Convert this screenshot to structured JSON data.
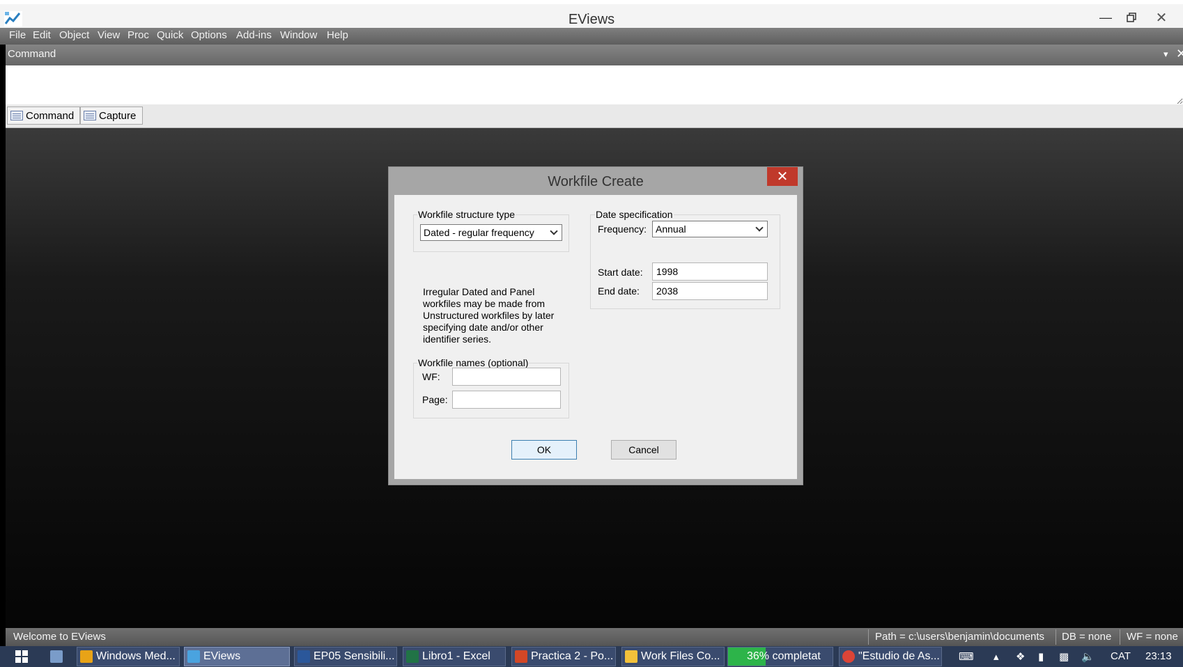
{
  "window": {
    "title": "EViews"
  },
  "menu": [
    "File",
    "Edit",
    "Object",
    "View",
    "Proc",
    "Quick",
    "Options",
    "Add-ins",
    "Window",
    "Help"
  ],
  "command": {
    "title": "Command",
    "tabs": [
      "Command",
      "Capture"
    ]
  },
  "dialog": {
    "title": "Workfile Create",
    "structure_group": "Workfile structure type",
    "structure_value": "Dated - regular frequency",
    "info": "Irregular Dated and Panel workfiles may be made from Unstructured workfiles by later specifying date and/or other identifier series.",
    "date_group": "Date specification",
    "frequency_label": "Frequency:",
    "frequency_value": "Annual",
    "start_label": "Start date:",
    "start_value": "1998",
    "end_label": "End date:",
    "end_value": "2038",
    "names_group": "Workfile names (optional)",
    "wf_label": "WF:",
    "wf_value": "",
    "page_label": "Page:",
    "page_value": "",
    "ok": "OK",
    "cancel": "Cancel"
  },
  "status": {
    "welcome": "Welcome to EViews",
    "path": "Path = c:\\users\\benjamin\\documents",
    "db": "DB = none",
    "wf": "WF = none"
  },
  "taskbar": {
    "items": [
      {
        "label": "Windows Med...",
        "color": "#e8a317"
      },
      {
        "label": "EViews",
        "color": "#4aa3df"
      },
      {
        "label": "EP05 Sensibili...",
        "color": "#2b579a"
      },
      {
        "label": "Libro1 - Excel",
        "color": "#217346"
      },
      {
        "label": "Practica 2 - Po...",
        "color": "#d24726"
      },
      {
        "label": "Work Files Co...",
        "color": "#f3c13a"
      },
      {
        "label": "36% completat",
        "color": "#2db44a",
        "progress": 0.36
      },
      {
        "label": "\"Estudio de As...",
        "color": "#db4437"
      }
    ],
    "lang": "CAT",
    "time": "23:13"
  }
}
